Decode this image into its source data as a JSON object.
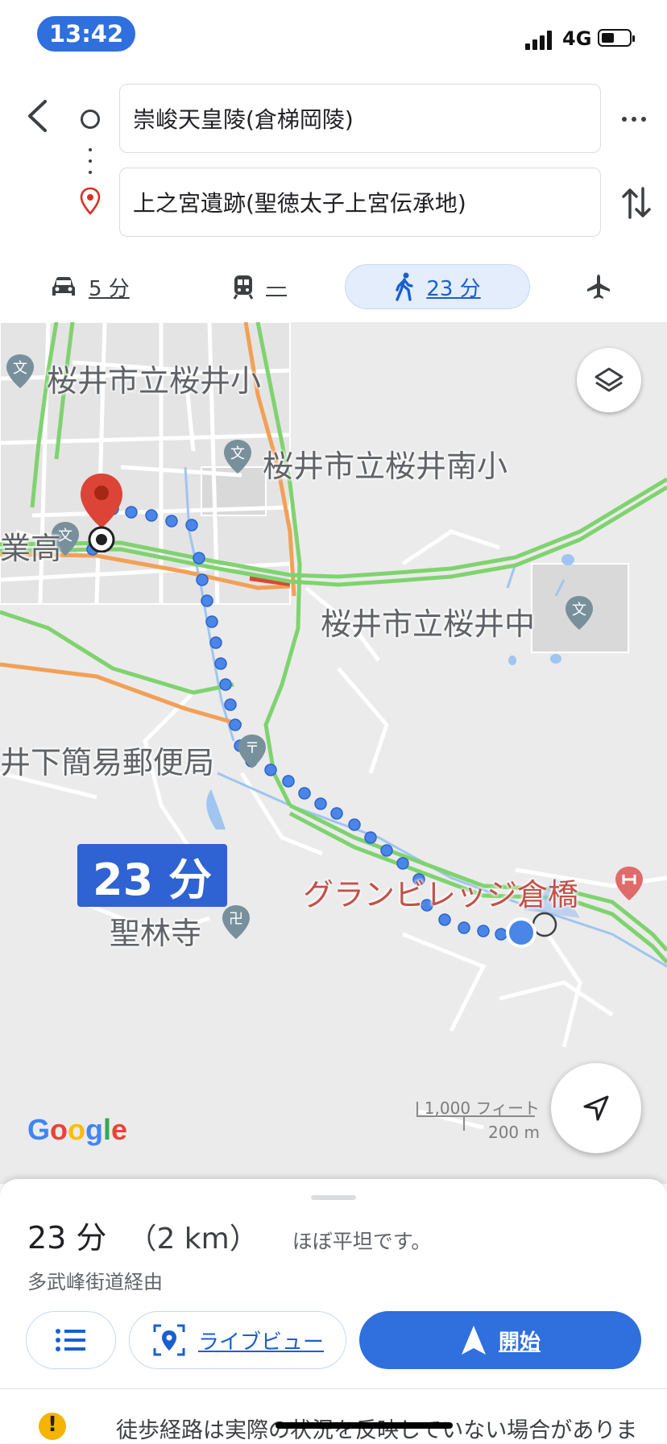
{
  "status_bar": {
    "time": "13:42",
    "network": "4G"
  },
  "route": {
    "origin": "崇峻天皇陵(倉梯岡陵)",
    "destination": "上之宮遺跡(聖徳太子上宮伝承地)"
  },
  "modes": {
    "drive": {
      "label": "5 分",
      "icon": "car-icon"
    },
    "transit": {
      "label": "—",
      "icon": "train-icon"
    },
    "walk": {
      "label": "23 分",
      "icon": "walk-icon",
      "selected": true
    },
    "flight": {
      "icon": "airplane-icon"
    }
  },
  "map": {
    "labels": {
      "school_sakurai": "桜井市立桜井小",
      "school_minami": "桜井市立桜井南小",
      "school_naka": "桜井市立桜井中",
      "high_school": "業高",
      "post_office": "井下簡易郵便局",
      "temple": "聖林寺",
      "hotel": "グランビレッジ倉橋"
    },
    "route_time": "23 分",
    "logo": "Google",
    "scale_ft": "1,000 フィート",
    "scale_m": "200 m",
    "colors": {
      "route_dots": "#4a86e8",
      "destination_pin": "#db4437",
      "highway": "#7fd36f",
      "arterial": "#f2a055"
    }
  },
  "sheet": {
    "duration": "23 分",
    "distance": "（2 km）",
    "terrain": "ほぼ平坦です。",
    "via": "多武峰街道経由",
    "live_view_label": "ライブビュー",
    "start_label": "開始",
    "warning": "徒歩経路は実際の状況を反映していない場合がありま"
  }
}
